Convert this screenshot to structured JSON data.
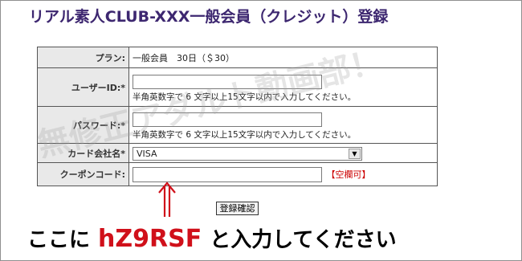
{
  "page_title": "リアル素人CLUB-XXX一般会員（クレジット）登録",
  "watermark": "無修正アダルト動画部！",
  "form": {
    "plan_label": "プラン:",
    "plan_value": "一般会員　30日（＄30）",
    "user_id_label": "ユーザーID:*",
    "user_id_hint": "半角英数字で 6 文字以上15文字以内で入力してください。",
    "password_label": "パスワード:*",
    "password_hint": "半角英数字で 6 文字以上15文字以内で入力してください。",
    "card_label": "カード会社名*",
    "card_value": "VISA",
    "coupon_label": "クーポンコード:",
    "coupon_optional": "【空欄可】"
  },
  "confirm_button": "登録確認",
  "instruction": {
    "before": "ここに",
    "code": "hZ9RSF",
    "after": "と入力してください"
  },
  "colors": {
    "title": "#3d2770",
    "label_bg": "#e9e9e9",
    "code": "#d0101a",
    "optional": "#cc0000"
  }
}
